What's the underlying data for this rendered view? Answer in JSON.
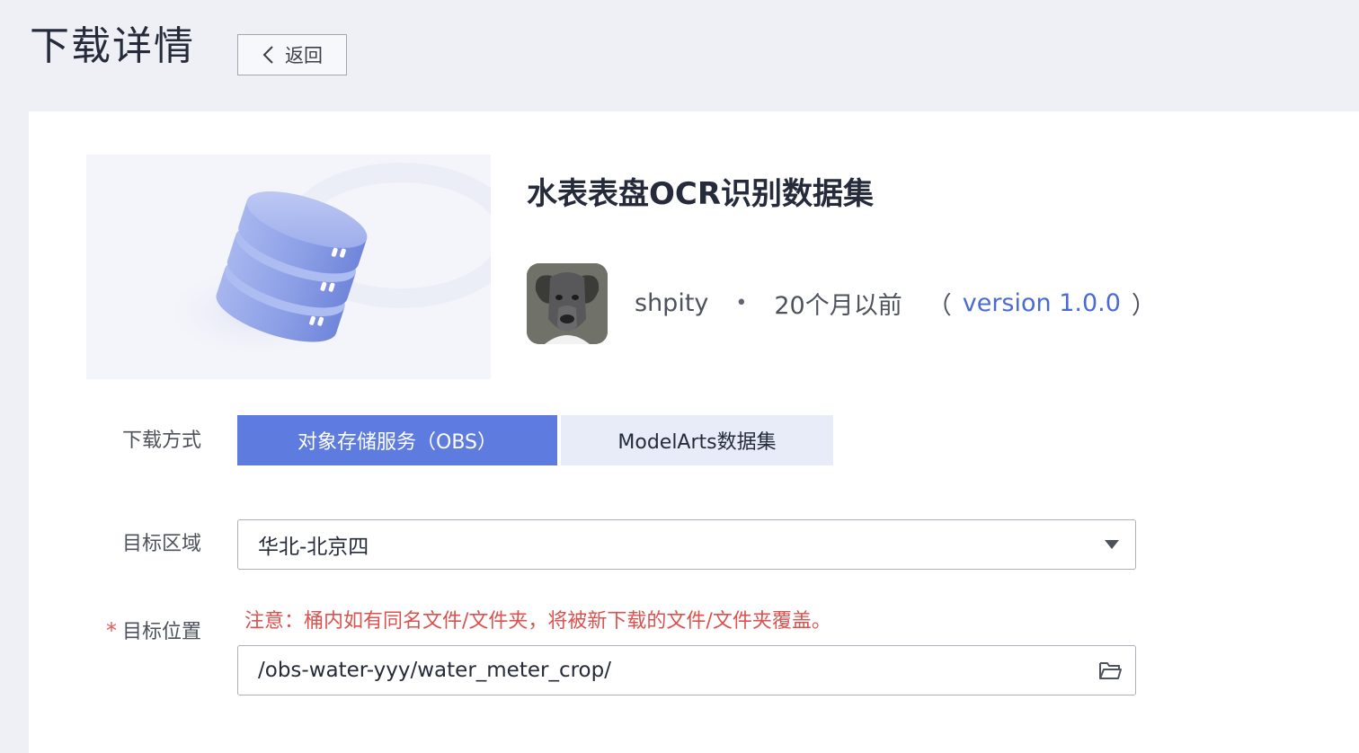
{
  "header": {
    "title": "下载详情",
    "back_label": "返回"
  },
  "dataset": {
    "title": "水表表盘OCR识别数据集",
    "author": "shpity",
    "separator": "•",
    "time": "20个月以前",
    "paren_open": "（",
    "version": "version 1.0.0",
    "paren_close": "）"
  },
  "form": {
    "method_label": "下载方式",
    "methods": [
      {
        "label": "对象存储服务（OBS）",
        "selected": true
      },
      {
        "label": "ModelArts数据集",
        "selected": false
      }
    ],
    "region_label": "目标区域",
    "region_value": "华北-北京四",
    "location_label": "目标位置",
    "required_mark": "*",
    "warning": "注意：桶内如有同名文件/文件夹，将被新下载的文件/文件夹覆盖。",
    "location_value": "/obs-water-yyy/water_meter_crop/"
  },
  "icons": {
    "back": "chevron-left-icon",
    "cover": "database-icon",
    "dropdown": "caret-down-icon",
    "folder": "folder-open-icon"
  },
  "colors": {
    "accent": "#5e7ce0",
    "link": "#4a6bd1",
    "warning": "#d9534f",
    "background": "#eff0f5"
  }
}
